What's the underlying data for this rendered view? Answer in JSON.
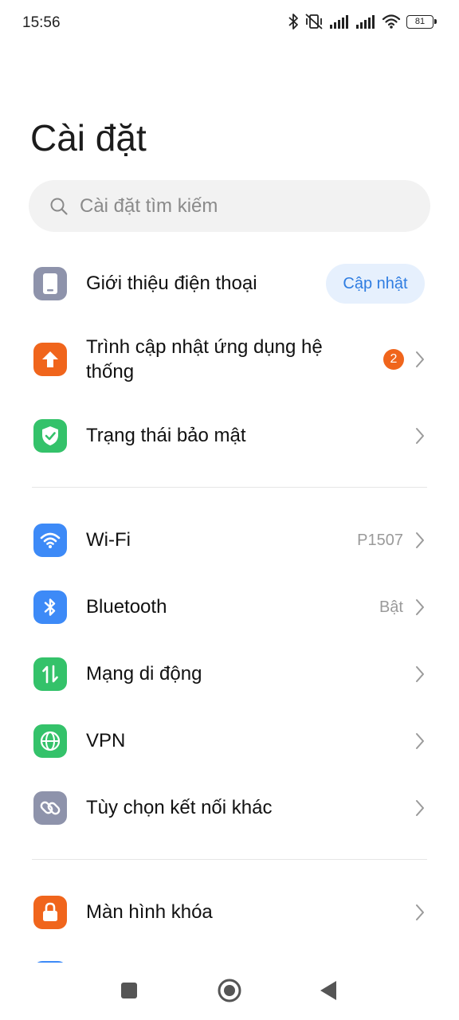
{
  "status_bar": {
    "time": "15:56",
    "battery": "81",
    "icons": [
      "bluetooth-icon",
      "vibrate-off-icon",
      "signal-icon",
      "signal-icon",
      "wifi-icon",
      "battery-icon"
    ]
  },
  "header": {
    "title": "Cài đặt"
  },
  "search": {
    "placeholder": "Cài đặt tìm kiếm"
  },
  "rows": {
    "about": {
      "label": "Giới thiệu điện thoại",
      "action": "Cập nhật",
      "icon": "phone-icon",
      "color": "#8e93ab"
    },
    "system_updater": {
      "label_line1": "Trình cập nhật ứng dụng hệ",
      "label_line2": "thống",
      "badge": "2",
      "icon": "arrow-up-icon",
      "color": "#f0651c"
    },
    "security": {
      "label": "Trạng thái bảo mật",
      "icon": "shield-check-icon",
      "color": "#34c26a"
    },
    "wifi": {
      "label": "Wi-Fi",
      "value": "P1507",
      "icon": "wifi-icon",
      "color": "#3d8af7"
    },
    "bluetooth": {
      "label": "Bluetooth",
      "value": "Bật",
      "icon": "bluetooth-icon",
      "color": "#3d8af7"
    },
    "mobile": {
      "label": "Mạng di động",
      "icon": "mobile-data-icon",
      "color": "#34c26a"
    },
    "vpn": {
      "label": "VPN",
      "icon": "globe-icon",
      "color": "#34c26a"
    },
    "more": {
      "label": "Tùy chọn kết nối khác",
      "icon": "link-icon",
      "color": "#8e93ab"
    },
    "lock": {
      "label": "Màn hình khóa",
      "icon": "lock-icon",
      "color": "#f0651c"
    }
  },
  "nav": {
    "icons": [
      "recents-square-icon",
      "home-circle-icon",
      "back-triangle-icon"
    ]
  },
  "colors": {
    "accent": "#2f7de1",
    "badge": "#f0651c"
  }
}
